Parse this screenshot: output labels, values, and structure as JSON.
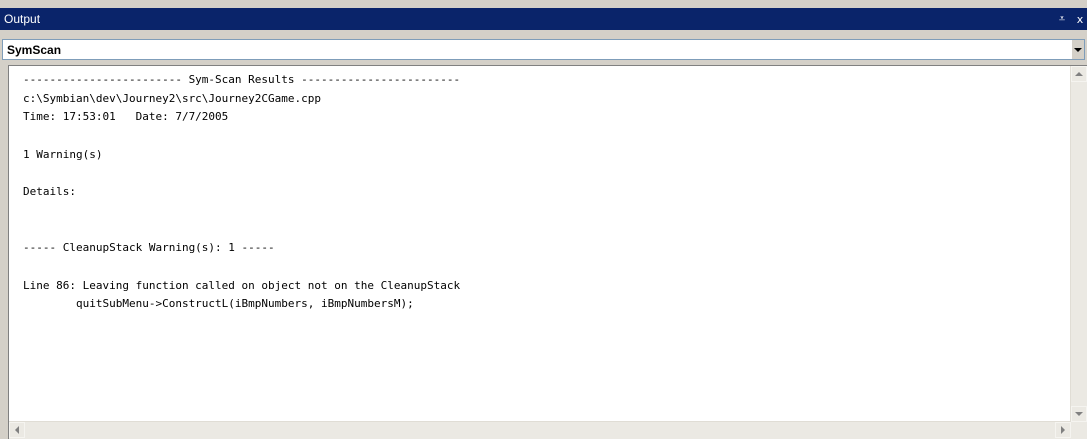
{
  "window": {
    "title": "Output",
    "pin_glyph": "⩡",
    "close_glyph": "x",
    "colors": {
      "titlebar": "#0a246a",
      "chrome": "#d4d0c8"
    }
  },
  "combo": {
    "selected": "SymScan"
  },
  "output": {
    "lines": [
      "------------------------ Sym-Scan Results ------------------------",
      "c:\\Symbian\\dev\\Journey2\\src\\Journey2CGame.cpp",
      "Time: 17:53:01   Date: 7/7/2005",
      "",
      "1 Warning(s)",
      "",
      "Details:",
      "",
      "",
      "----- CleanupStack Warning(s): 1 -----",
      "",
      "Line 86: Leaving function called on object not on the CleanupStack",
      "        quitSubMenu->ConstructL(iBmpNumbers, iBmpNumbersM);"
    ]
  },
  "icons": {
    "pin": "pin-icon",
    "close": "close-icon",
    "dropdown": "chevron-down-icon",
    "scroll_up": "scroll-up-arrow-icon",
    "scroll_down": "scroll-down-arrow-icon",
    "scroll_left": "scroll-left-arrow-icon",
    "scroll_right": "scroll-right-arrow-icon"
  }
}
